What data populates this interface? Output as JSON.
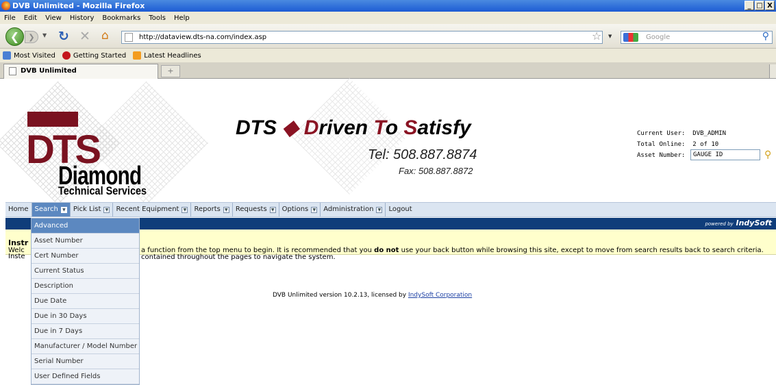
{
  "window": {
    "title": "DVB Unlimited - Mozilla Firefox",
    "min": "_",
    "max": "□",
    "close": "X"
  },
  "menubar": [
    "File",
    "Edit",
    "View",
    "History",
    "Bookmarks",
    "Tools",
    "Help"
  ],
  "nav": {
    "url": "http://dataview.dts-na.com/index.asp",
    "search_placeholder": "Google"
  },
  "bookmarks": [
    "Most Visited",
    "Getting Started",
    "Latest Headlines"
  ],
  "tab": {
    "title": "DVB Unlimited",
    "new": "+"
  },
  "logo": {
    "letters": "DTS",
    "word": "Diamond",
    "sub": "Technical Services"
  },
  "slogan": {
    "p1": "DTS ",
    "diamond": "◆ ",
    "d": "D",
    "riven": "riven ",
    "t": "T",
    "o": "o ",
    "s": "S",
    "atisfy": "atisfy"
  },
  "contact": {
    "tel": "Tel: 508.887.8874",
    "fax": "Fax: 508.887.8872"
  },
  "userinfo": {
    "current_user_label": "Current User:",
    "current_user": "DVB_ADMIN",
    "total_online_label": "Total Online:",
    "total_online": "2 of 10",
    "asset_label": "Asset Number:",
    "asset_value": "GAUGE ID"
  },
  "mainmenu": [
    "Home",
    "Search",
    "Pick List",
    "Recent Equipment",
    "Reports",
    "Requests",
    "Options",
    "Administration",
    "Logout"
  ],
  "powered": {
    "by": "powered by",
    "brand": "IndySoft"
  },
  "instructions": {
    "title": "Instr",
    "l1": "Welc",
    "l2": "Inste",
    "t1a": "a function from the top menu to begin. It is recommended that you ",
    "t1b": "do not",
    "t1c": " use your back button while browsing this site, except to move from search results back to search criteria.",
    "t2": "contained throughout the pages to navigate the system."
  },
  "footer": {
    "text": "DVB Unlimited version 10.2.13, licensed by ",
    "link": "IndySoft Corporation"
  },
  "search_dropdown": [
    "Advanced",
    "Asset Number",
    "Cert Number",
    "Current Status",
    "Description",
    "Due Date",
    "Due in 30 Days",
    "Due in 7 Days",
    "Manufacturer / Model Number",
    "Serial Number",
    "User Defined Fields"
  ]
}
